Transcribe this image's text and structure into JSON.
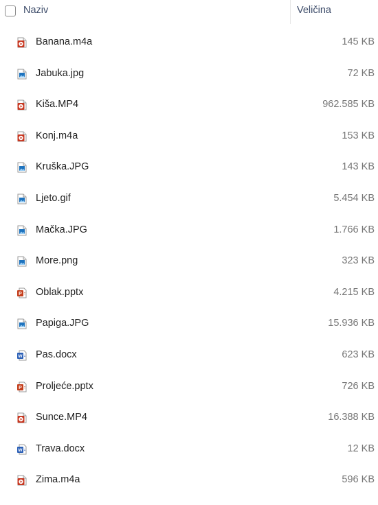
{
  "header": {
    "name_label": "Naziv",
    "size_label": "Veličina",
    "sort_indicator": "^"
  },
  "files": [
    {
      "name": "Banana.m4a",
      "size": "145 KB",
      "icon": "media-icon"
    },
    {
      "name": "Jabuka.jpg",
      "size": "72 KB",
      "icon": "image-icon"
    },
    {
      "name": "Kiša.MP4",
      "size": "962.585 KB",
      "icon": "media-icon"
    },
    {
      "name": "Konj.m4a",
      "size": "153 KB",
      "icon": "media-icon"
    },
    {
      "name": "Kruška.JPG",
      "size": "143 KB",
      "icon": "image-icon"
    },
    {
      "name": "Ljeto.gif",
      "size": "5.454 KB",
      "icon": "image-icon"
    },
    {
      "name": "Mačka.JPG",
      "size": "1.766 KB",
      "icon": "image-icon"
    },
    {
      "name": "More.png",
      "size": "323 KB",
      "icon": "image-icon"
    },
    {
      "name": "Oblak.pptx",
      "size": "4.215 KB",
      "icon": "powerpoint-icon"
    },
    {
      "name": "Papiga.JPG",
      "size": "15.936 KB",
      "icon": "image-icon"
    },
    {
      "name": "Pas.docx",
      "size": "623 KB",
      "icon": "word-icon"
    },
    {
      "name": "Proljeće.pptx",
      "size": "726 KB",
      "icon": "powerpoint-icon"
    },
    {
      "name": "Sunce.MP4",
      "size": "16.388 KB",
      "icon": "media-icon"
    },
    {
      "name": "Trava.docx",
      "size": "12 KB",
      "icon": "word-icon"
    },
    {
      "name": "Zima.m4a",
      "size": "596 KB",
      "icon": "media-icon"
    }
  ],
  "colors": {
    "media": "#c7361f",
    "image": "#1e73be",
    "powerpoint": "#c43e1c",
    "word": "#2b5fb6"
  }
}
